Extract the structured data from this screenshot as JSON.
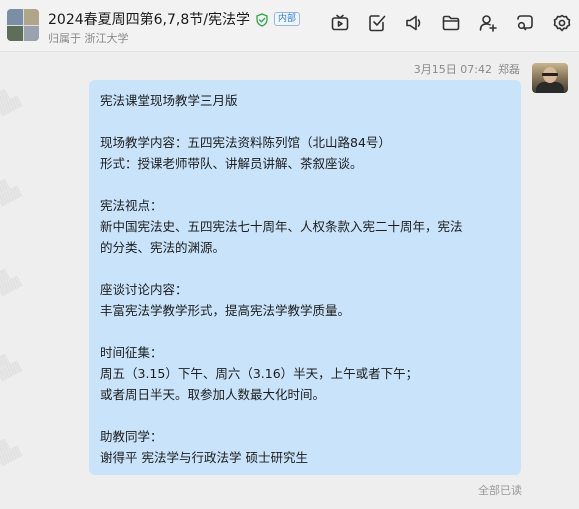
{
  "header": {
    "title": "2024春夏周四第6,7,8节/宪法学",
    "badge": "内部",
    "subtitle": "归属于 浙江大学",
    "verify_icon": "shield-check-icon",
    "toolbar": [
      {
        "name": "tv-icon"
      },
      {
        "name": "task-check-icon"
      },
      {
        "name": "announcement-icon"
      },
      {
        "name": "folder-icon"
      },
      {
        "name": "add-member-icon"
      },
      {
        "name": "search-icon"
      },
      {
        "name": "settings-icon"
      }
    ]
  },
  "message": {
    "timestamp": "3月15日 07:42",
    "sender": "郑磊",
    "paragraphs": [
      [
        "宪法课堂现场教学三月版"
      ],
      [
        "现场教学内容：五四宪法资料陈列馆（北山路84号）",
        "形式：授课老师带队、讲解员讲解、茶叙座谈。"
      ],
      [
        "宪法视点：",
        "新中国宪法史、五四宪法七十周年、人权条款入宪二十周年，宪法",
        "的分类、宪法的渊源。"
      ],
      [
        "座谈讨论内容：",
        "丰富宪法学教学形式，提高宪法学教学质量。"
      ],
      [
        "时间征集：",
        "周五（3.15）下午、周六（3.16）半天，上午或者下午；",
        "或者周日半天。取参加人数最大化时间。"
      ],
      [
        "助教同学：",
        "谢得平 宪法学与行政法学 硕士研究生"
      ]
    ],
    "read_status": "全部已读"
  },
  "colors": {
    "bubble": "#c8e3fa",
    "background": "#eeeeee",
    "badge": "#2e7bd8",
    "verify": "#2aa84a"
  }
}
